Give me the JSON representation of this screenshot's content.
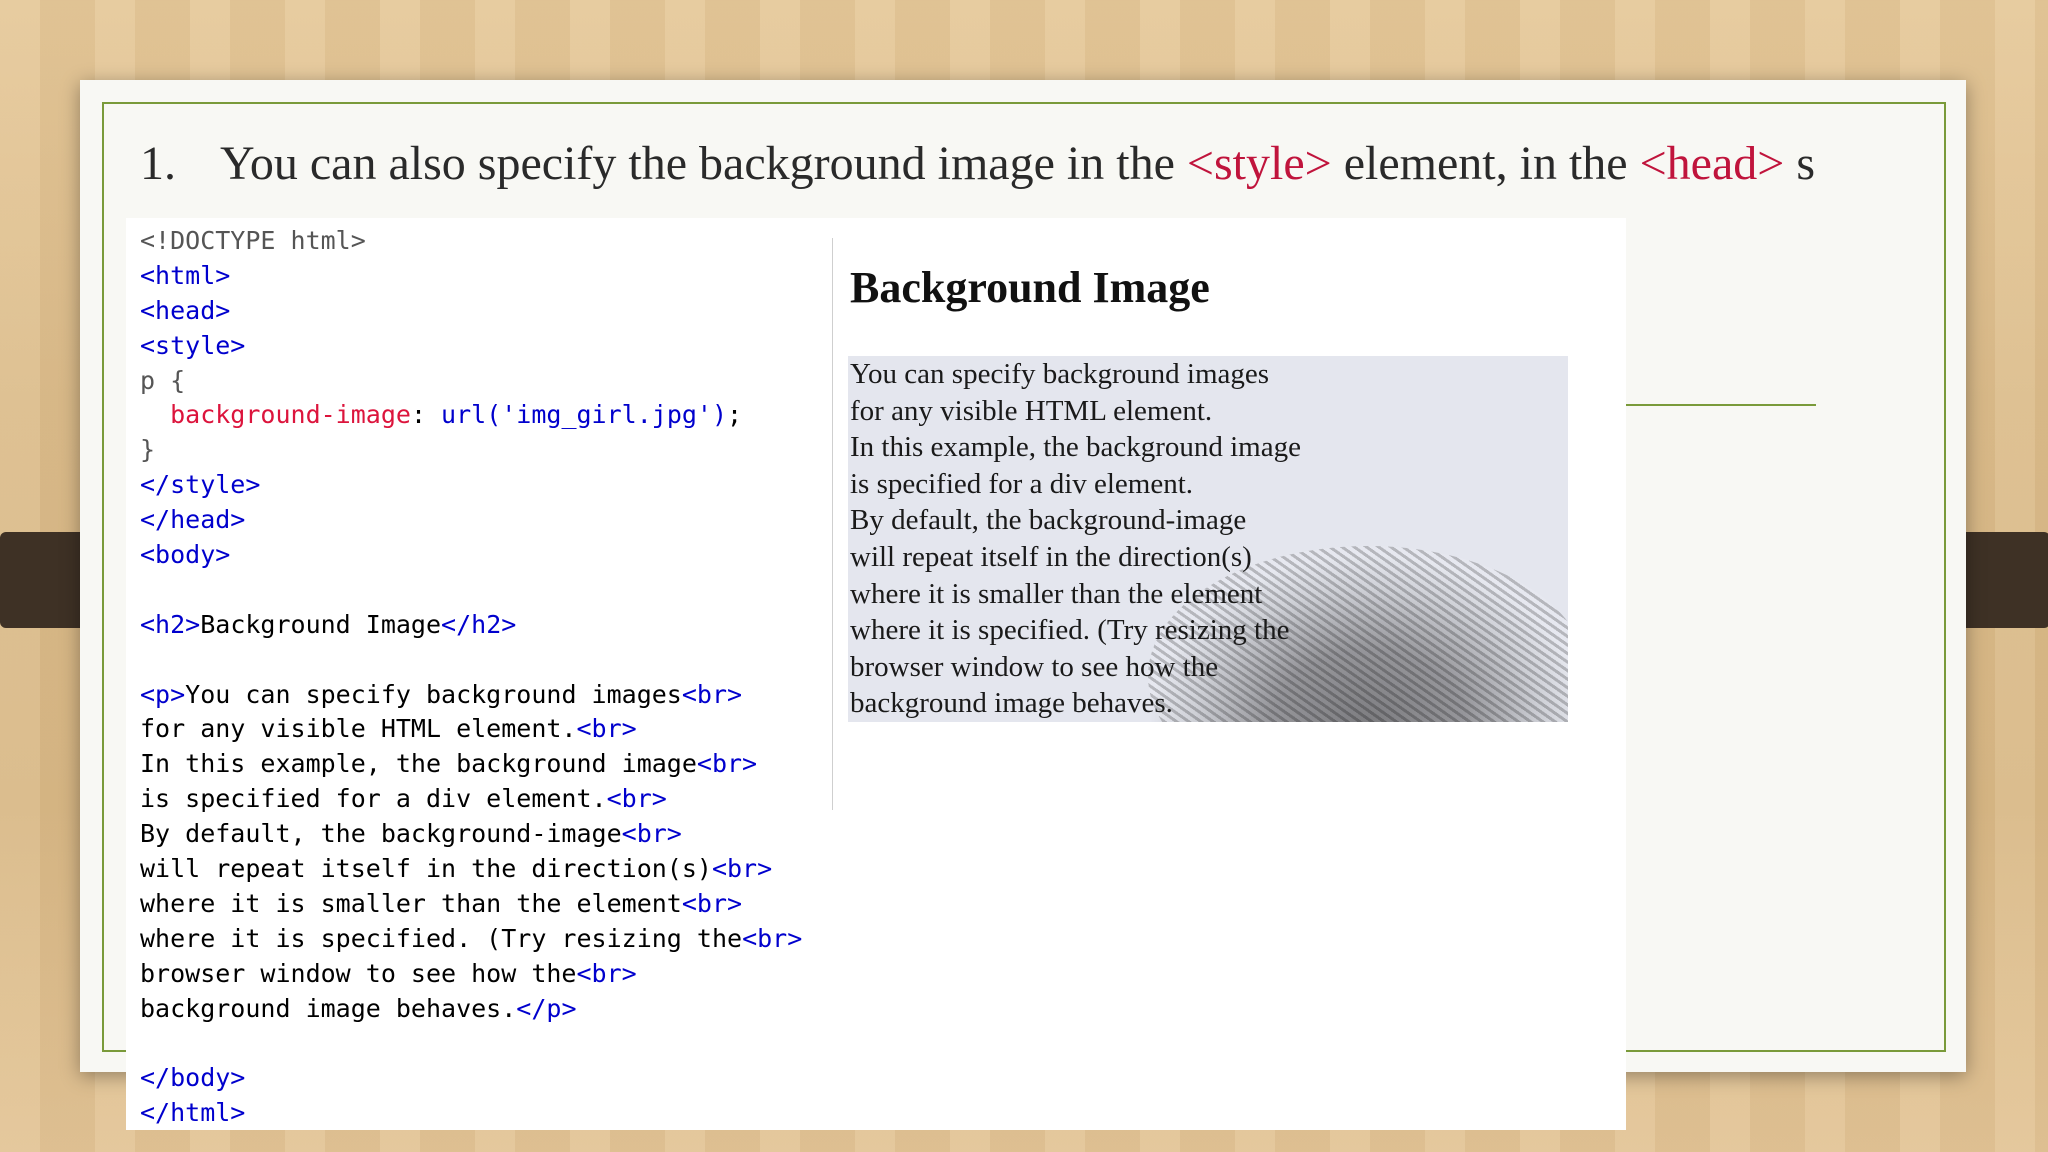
{
  "heading": {
    "number": "1.",
    "before": "You can also specify the background image in the ",
    "tag1": "<style>",
    "middle": " element, in the ",
    "tag2": "<head>",
    "after": " s"
  },
  "code_lines": [
    [
      {
        "t": "<!DOCTYPE html>",
        "c": "c-gray"
      }
    ],
    [
      {
        "t": "<html>",
        "c": "c-tag"
      }
    ],
    [
      {
        "t": "<head>",
        "c": "c-tag"
      }
    ],
    [
      {
        "t": "<style>",
        "c": "c-tag"
      }
    ],
    [
      {
        "t": "p {",
        "c": "c-gray"
      }
    ],
    [
      {
        "t": "  background-image",
        "c": "c-prop"
      },
      {
        "t": ": ",
        "c": "c-plain"
      },
      {
        "t": "url('img_girl.jpg')",
        "c": "c-val"
      },
      {
        "t": ";",
        "c": "c-plain"
      }
    ],
    [
      {
        "t": "}",
        "c": "c-gray"
      }
    ],
    [
      {
        "t": "</style>",
        "c": "c-tag"
      }
    ],
    [
      {
        "t": "</head>",
        "c": "c-tag"
      }
    ],
    [
      {
        "t": "<body>",
        "c": "c-tag"
      }
    ],
    [],
    [
      {
        "t": "<h2>",
        "c": "c-tag"
      },
      {
        "t": "Background Image",
        "c": "c-plain"
      },
      {
        "t": "</h2>",
        "c": "c-tag"
      }
    ],
    [],
    [
      {
        "t": "<p>",
        "c": "c-tag"
      },
      {
        "t": "You can specify background images",
        "c": "c-plain"
      },
      {
        "t": "<br>",
        "c": "c-tag"
      }
    ],
    [
      {
        "t": "for any visible HTML element.",
        "c": "c-plain"
      },
      {
        "t": "<br>",
        "c": "c-tag"
      }
    ],
    [
      {
        "t": "In this example, the background image",
        "c": "c-plain"
      },
      {
        "t": "<br>",
        "c": "c-tag"
      }
    ],
    [
      {
        "t": "is specified for a div element.",
        "c": "c-plain"
      },
      {
        "t": "<br>",
        "c": "c-tag"
      }
    ],
    [
      {
        "t": "By default, the background-image",
        "c": "c-plain"
      },
      {
        "t": "<br>",
        "c": "c-tag"
      }
    ],
    [
      {
        "t": "will repeat itself in the direction(s)",
        "c": "c-plain"
      },
      {
        "t": "<br>",
        "c": "c-tag"
      }
    ],
    [
      {
        "t": "where it is smaller than the element",
        "c": "c-plain"
      },
      {
        "t": "<br>",
        "c": "c-tag"
      }
    ],
    [
      {
        "t": "where it is specified. (Try resizing the",
        "c": "c-plain"
      },
      {
        "t": "<br>",
        "c": "c-tag"
      }
    ],
    [
      {
        "t": "browser window to see how the",
        "c": "c-plain"
      },
      {
        "t": "<br>",
        "c": "c-tag"
      }
    ],
    [
      {
        "t": "background image behaves.",
        "c": "c-plain"
      },
      {
        "t": "</p>",
        "c": "c-tag"
      }
    ],
    [],
    [
      {
        "t": "</body>",
        "c": "c-tag"
      }
    ],
    [
      {
        "t": "</html>",
        "c": "c-tag"
      }
    ]
  ],
  "render": {
    "title": "Background Image",
    "paragraph_lines": [
      "You can specify background images",
      "for any visible HTML element.",
      "In this example, the background image",
      "is specified for a div element.",
      "By default, the background-image",
      "will repeat itself in the direction(s)",
      "where it is smaller than the element",
      "where it is specified. (Try resizing the",
      "browser window to see how the",
      "background image behaves."
    ]
  },
  "colors": {
    "accent_green": "#7a9a3a",
    "tag_red": "#c0143c",
    "code_blue": "#0000cd",
    "code_crimson": "#dc143c"
  }
}
